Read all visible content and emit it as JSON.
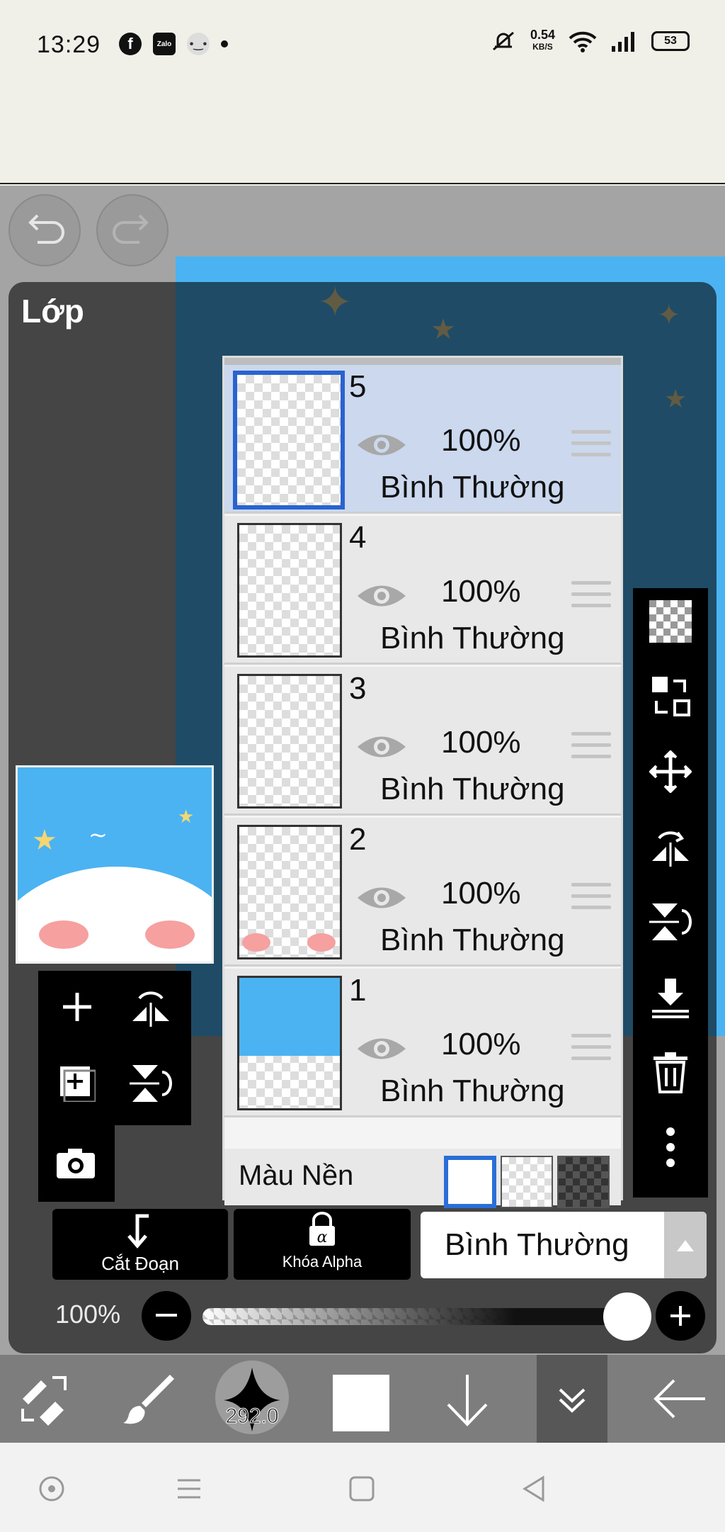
{
  "status_bar": {
    "time": "13:29",
    "left_icons": [
      "facebook-icon",
      "zalo-icon",
      "messenger-icon",
      "dot-icon"
    ],
    "zalo_text": "Zalo",
    "speed_value": "0.54",
    "speed_unit": "KB/S",
    "battery": "53"
  },
  "panel": {
    "title": "Lớp"
  },
  "layers": [
    {
      "number": "5",
      "opacity": "100%",
      "blend": "Bình Thường",
      "selected": true
    },
    {
      "number": "4",
      "opacity": "100%",
      "blend": "Bình Thường",
      "selected": false
    },
    {
      "number": "3",
      "opacity": "100%",
      "blend": "Bình Thường",
      "selected": false
    },
    {
      "number": "2",
      "opacity": "100%",
      "blend": "Bình Thường",
      "selected": false
    },
    {
      "number": "1",
      "opacity": "100%",
      "blend": "Bình Thường",
      "selected": false
    }
  ],
  "background_row": {
    "label": "Màu Nền",
    "selected": "white"
  },
  "controls": {
    "clipping_label": "Cắt Đoạn",
    "alpha_lock_label": "Khóa Alpha",
    "blend_mode_value": "Bình Thường",
    "opacity_value": "100%",
    "opacity_fraction": 1.0
  },
  "toolbar": {
    "brush_size": "292.0"
  },
  "colors": {
    "sky_blue": "#4bb3f2",
    "selected_layer_bg": "#cbd8ee",
    "selection_border": "#2a62d0"
  }
}
